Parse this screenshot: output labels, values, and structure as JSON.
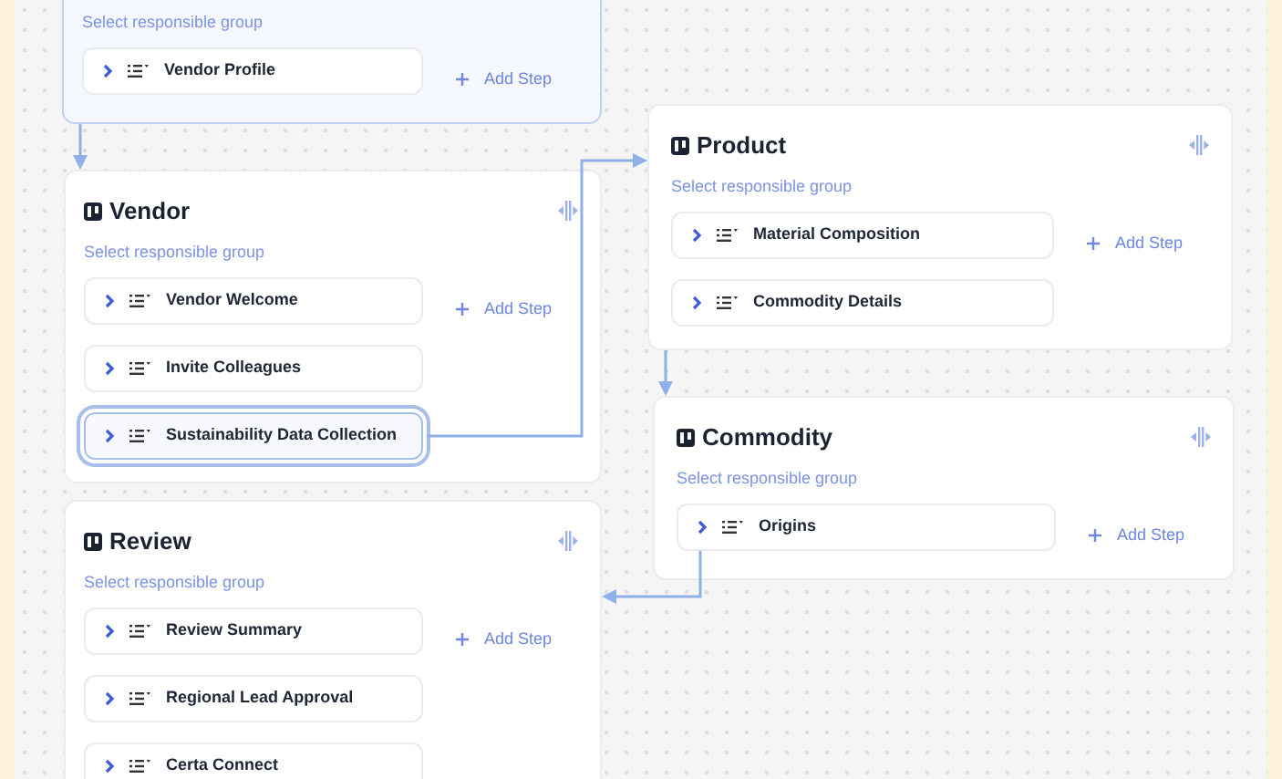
{
  "cards": [
    {
      "subtitle": "Select responsible group",
      "selected": true,
      "steps": [
        {
          "label": "Vendor Profile",
          "selected": false
        }
      ],
      "add_step": "Add Step"
    },
    {
      "title": "Vendor",
      "subtitle": "Select responsible group",
      "selected": false,
      "steps": [
        {
          "label": "Vendor Welcome",
          "selected": false
        },
        {
          "label": "Invite Colleagues",
          "selected": false
        },
        {
          "label": "Sustainability Data Collection",
          "selected": true
        }
      ],
      "add_step": "Add Step"
    },
    {
      "title": "Review",
      "subtitle": "Select responsible group",
      "selected": false,
      "steps": [
        {
          "label": "Review Summary",
          "selected": false
        },
        {
          "label": "Regional Lead Approval",
          "selected": false
        },
        {
          "label": "Certa Connect",
          "selected": false
        }
      ],
      "add_step": "Add Step"
    },
    {
      "title": "Product",
      "subtitle": "Select responsible group",
      "selected": false,
      "steps": [
        {
          "label": "Material Composition",
          "selected": false
        },
        {
          "label": "Commodity Details",
          "selected": false
        }
      ],
      "add_step": "Add Step"
    },
    {
      "title": "Commodity",
      "subtitle": "Select responsible group",
      "selected": false,
      "steps": [
        {
          "label": "Origins",
          "selected": false
        }
      ],
      "add_step": "Add Step"
    }
  ]
}
